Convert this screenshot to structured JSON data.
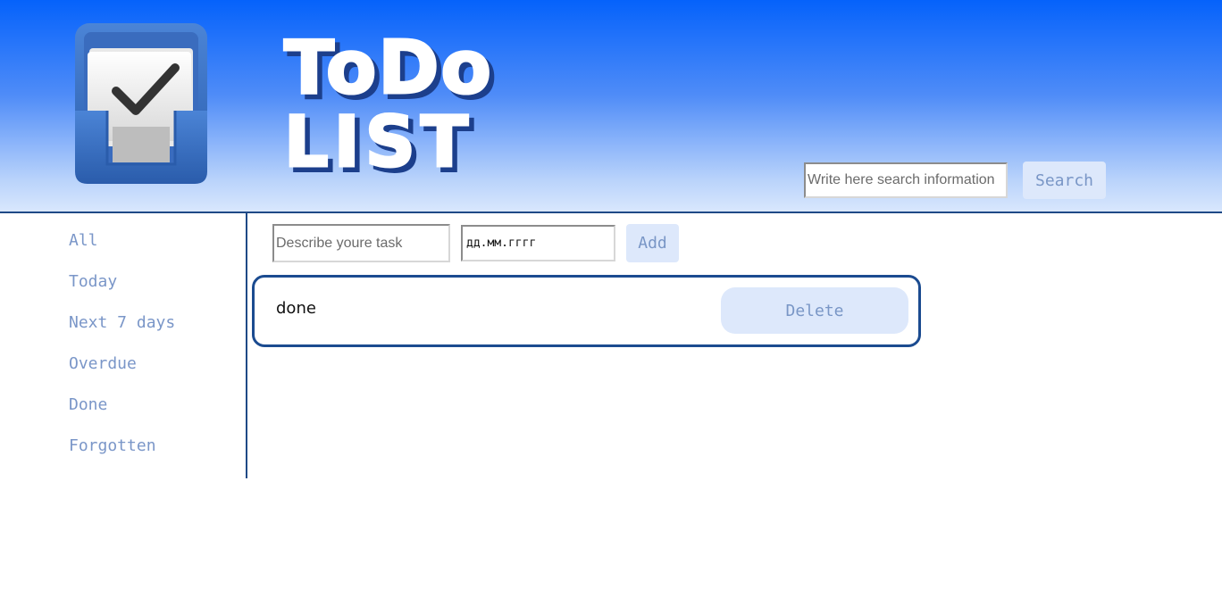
{
  "header": {
    "logo_icon": "todo-inbox-check-icon",
    "title_line1": "ToDo",
    "title_line2": "LIST",
    "search": {
      "placeholder": "Write here search information",
      "value": "",
      "button_label": "Search"
    }
  },
  "sidebar": {
    "items": [
      {
        "label": "All"
      },
      {
        "label": "Today"
      },
      {
        "label": "Next 7 days"
      },
      {
        "label": "Overdue"
      },
      {
        "label": "Done"
      },
      {
        "label": "Forgotten"
      }
    ]
  },
  "new_task": {
    "description_placeholder": "Describe youre task",
    "description_value": "",
    "date_value": "дд.мм.гггг",
    "add_label": "Add"
  },
  "tasks": [
    {
      "text": "done",
      "delete_label": "Delete"
    }
  ],
  "colors": {
    "header_top": "#0562fb",
    "header_bottom": "#d9e7fd",
    "accent_border": "#1b4b90",
    "button_bg": "#dde8fb",
    "button_text": "#7996c6",
    "sidebar_text": "#7a96c8"
  }
}
